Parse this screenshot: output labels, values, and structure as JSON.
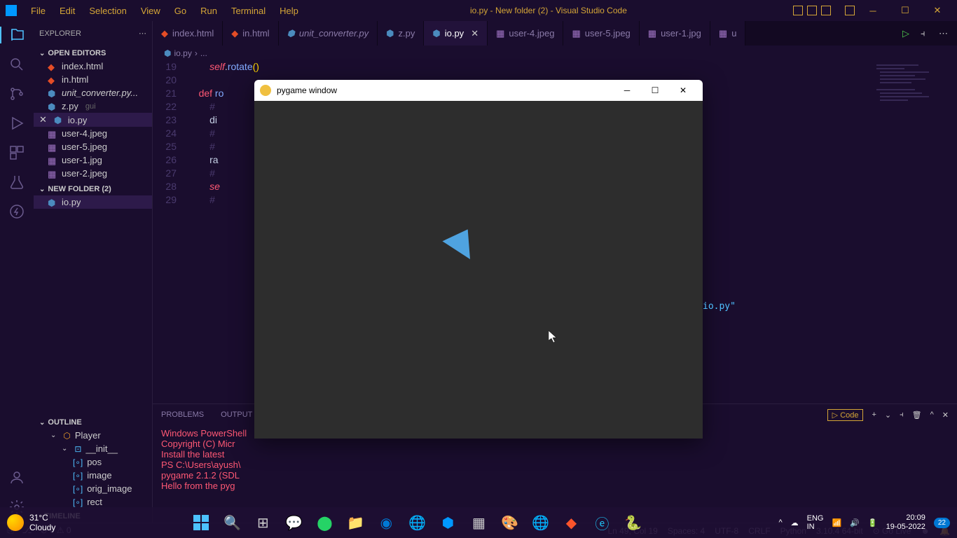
{
  "titlebar": {
    "menu": [
      "File",
      "Edit",
      "Selection",
      "View",
      "Go",
      "Run",
      "Terminal",
      "Help"
    ],
    "title": "io.py - New folder (2) - Visual Studio Code"
  },
  "sidebar": {
    "header": "EXPLORER",
    "openEditors": {
      "title": "OPEN EDITORS",
      "items": [
        {
          "name": "index.html",
          "type": "html"
        },
        {
          "name": "in.html",
          "type": "html"
        },
        {
          "name": "unit_converter.py...",
          "type": "py",
          "italic": true
        },
        {
          "name": "z.py",
          "type": "py",
          "suffix": "gui"
        },
        {
          "name": "io.py",
          "type": "py",
          "active": true,
          "closable": true
        },
        {
          "name": "user-4.jpeg",
          "type": "img"
        },
        {
          "name": "user-5.jpeg",
          "type": "img"
        },
        {
          "name": "user-1.jpg",
          "type": "img"
        },
        {
          "name": "user-2.jpeg",
          "type": "img"
        }
      ]
    },
    "folder": {
      "title": "NEW FOLDER (2)",
      "items": [
        {
          "name": "io.py",
          "type": "py"
        }
      ]
    },
    "outline": {
      "title": "OUTLINE",
      "items": [
        {
          "name": "Player",
          "type": "class",
          "level": 0
        },
        {
          "name": "__init__",
          "type": "method",
          "level": 1
        },
        {
          "name": "pos",
          "type": "var",
          "level": 2
        },
        {
          "name": "image",
          "type": "var",
          "level": 2
        },
        {
          "name": "orig_image",
          "type": "var",
          "level": 2
        },
        {
          "name": "rect",
          "type": "var",
          "level": 2
        }
      ]
    },
    "timeline": "TIMELINE"
  },
  "tabs": [
    {
      "name": "index.html",
      "icon": "html"
    },
    {
      "name": "in.html",
      "icon": "html"
    },
    {
      "name": "unit_converter.py",
      "icon": "py",
      "italic": true
    },
    {
      "name": "z.py",
      "icon": "py"
    },
    {
      "name": "io.py",
      "icon": "py",
      "active": true
    },
    {
      "name": "user-4.jpeg",
      "icon": "img"
    },
    {
      "name": "user-5.jpeg",
      "icon": "img"
    },
    {
      "name": "user-1.jpg",
      "icon": "img"
    },
    {
      "name": "u",
      "icon": "img"
    }
  ],
  "breadcrumb": [
    "io.py",
    "..."
  ],
  "code": {
    "startLine": 19,
    "lines": [
      {
        "n": 19,
        "html": "        <span class='kw-self'>self</span>.<span class='fn-name'>rotate</span><span class='paren'>()</span>"
      },
      {
        "n": 20,
        "html": ""
      },
      {
        "n": 21,
        "html": "    <span class='kw-def'>def</span> <span class='fn-name'>ro</span>"
      },
      {
        "n": 22,
        "html": "        <span class='comment'>#</span>"
      },
      {
        "n": 23,
        "html": "        <span class='var'>di</span>"
      },
      {
        "n": 24,
        "html": "        <span class='comment'>#</span>"
      },
      {
        "n": 25,
        "html": "        <span class='comment'>#</span>"
      },
      {
        "n": 26,
        "html": "        <span class='var'>ra</span>"
      },
      {
        "n": 27,
        "html": "        <span class='comment'>#</span>"
      },
      {
        "n": 28,
        "html": "        <span class='kw-self'>se</span>"
      },
      {
        "n": 29,
        "html": "        <span class='comment'>#</span>"
      }
    ]
  },
  "panel": {
    "tabs": [
      "PROBLEMS",
      "OUTPUT"
    ],
    "codeLabel": "Code",
    "terminal": [
      "Windows PowerShell",
      "Copyright (C) Micr",
      "",
      "Install the latest",
      "",
      "PS C:\\Users\\ayush\\",
      "pygame 2.1.2 (SDL ",
      "Hello from the pyg"
    ],
    "terminalSuffix": "io.py\""
  },
  "statusbar": {
    "left": [
      "⊘ 0 ⚠ 0"
    ],
    "right": [
      "Ln 49, Col 19",
      "Spaces: 4",
      "UTF-8",
      "CRLF",
      "Python",
      "3.10.4 64-bit",
      "⊙ Go Live"
    ]
  },
  "pygame": {
    "title": "pygame window"
  },
  "taskbar": {
    "weather": {
      "temp": "31°C",
      "desc": "Cloudy"
    },
    "lang": "ENG",
    "region": "IN",
    "time": "20:09",
    "date": "19-05-2022",
    "notif": "22"
  }
}
